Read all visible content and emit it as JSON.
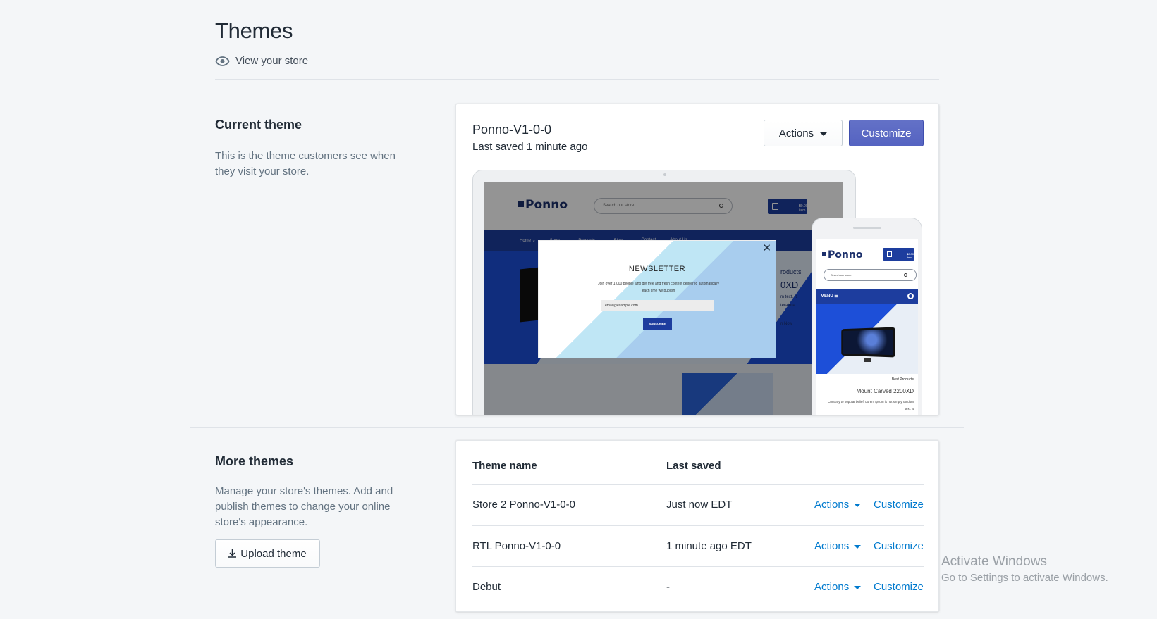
{
  "header": {
    "title": "Themes",
    "view_store": "View your store"
  },
  "current": {
    "section_title": "Current theme",
    "section_desc": "This is the theme customers see when they visit your store.",
    "theme_name": "Ponno-V1-0-0",
    "last_saved": "Last saved 1 minute ago",
    "actions_label": "Actions",
    "customize_label": "Customize"
  },
  "preview": {
    "logo": "Ponno",
    "search_placeholder": "Search our store",
    "cart_line1": "0 item",
    "cart_line2": "$0.00",
    "nav": [
      "Home ⌄",
      "Shop ⌄",
      "Products ⌄",
      "Blog ⌄",
      "Contact",
      "About Us"
    ],
    "hero_text": [
      "roducts",
      "0XD",
      "m text. It",
      "terature.",
      "n Now"
    ],
    "popup": {
      "title": "NEWSLETTER",
      "text": "Join over 1,000 people who get free and fresh content delivered automatically each time we publish",
      "email": "email@example.com",
      "button": "SUBSCRIBE"
    },
    "mobile": {
      "menu": "MENU ☰",
      "label": "Best Products",
      "title": "Mount Carved 2200XD",
      "desc": "Contrary to popular belief, Lorem Ipsum is not simply random text. It"
    }
  },
  "more": {
    "section_title": "More themes",
    "section_desc": "Manage your store's themes. Add and publish themes to change your online store's appearance.",
    "upload_label": "Upload theme",
    "columns": [
      "Theme name",
      "Last saved"
    ],
    "rows": [
      {
        "name": "Store 2 Ponno-V1-0-0",
        "saved": "Just now EDT",
        "actions": "Actions",
        "customize": "Customize"
      },
      {
        "name": "RTL Ponno-V1-0-0",
        "saved": "1 minute ago EDT",
        "actions": "Actions",
        "customize": "Customize"
      },
      {
        "name": "Debut",
        "saved": "-",
        "actions": "Actions",
        "customize": "Customize"
      }
    ]
  },
  "watermark": {
    "line1": "Activate Windows",
    "line2": "Go to Settings to activate Windows."
  },
  "colors": {
    "primary": "#5c6ac4",
    "link": "#007ace",
    "background": "#f4f6f8"
  }
}
